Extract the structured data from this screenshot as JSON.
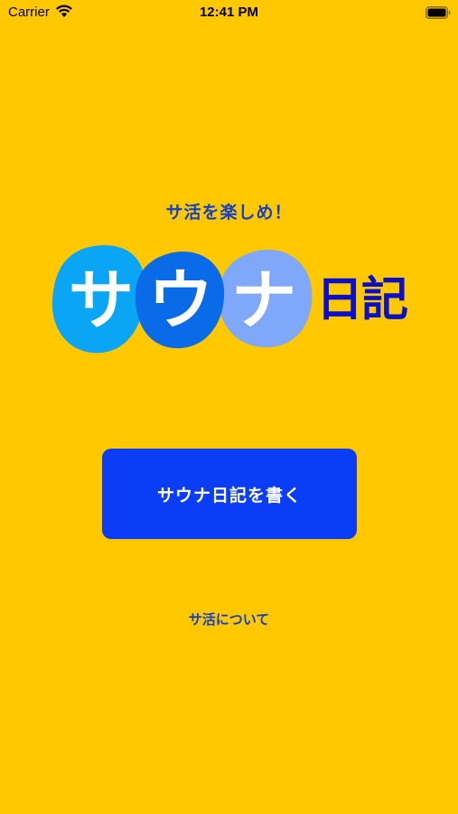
{
  "status_bar": {
    "carrier": "Carrier",
    "time": "12:41 PM"
  },
  "tagline": "サ活を楽しめ！",
  "logo": {
    "chars": [
      "サ",
      "ウ",
      "ナ"
    ],
    "suffix": "日記"
  },
  "primary_button": {
    "label": "サウナ日記を書く"
  },
  "about_link": {
    "label": "サ活について"
  },
  "colors": {
    "background": "#FFC800",
    "accent_text": "#1440C8",
    "button": "#0A3DF5",
    "blob_1": "#0AA5F5",
    "blob_2": "#0A6BE8",
    "blob_3": "#7FA8FA"
  },
  "icons": [
    "wifi-icon",
    "battery-icon"
  ]
}
